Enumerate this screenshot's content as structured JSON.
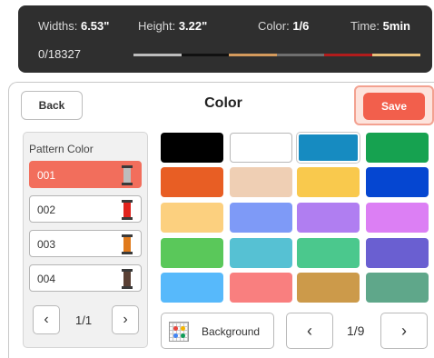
{
  "status": {
    "widths_label": "Widths:",
    "widths_value": "6.53\"",
    "height_label": "Height:",
    "height_value": "3.22\"",
    "color_label": "Color:",
    "color_value": "1/6",
    "time_label": "Time:",
    "time_value": "5min",
    "counter": "0/18327",
    "progress_colors": [
      "#bdbdbd",
      "#111111",
      "#d49a5c",
      "#6f6f6f",
      "#b21c1c",
      "#e8c07a"
    ]
  },
  "header": {
    "back_label": "Back",
    "title": "Color",
    "save_label": "Save"
  },
  "pattern": {
    "label": "Pattern Color",
    "items": [
      {
        "number": "001",
        "color": "#bdbdbd",
        "active": true
      },
      {
        "number": "002",
        "color": "#e0241e",
        "active": false
      },
      {
        "number": "003",
        "color": "#e07a1c",
        "active": false
      },
      {
        "number": "004",
        "color": "#5a4034",
        "active": false
      }
    ],
    "page_text": "1/1",
    "prev_icon": "chevron-left-icon",
    "next_icon": "chevron-right-icon"
  },
  "palette": {
    "swatches": [
      "#000000",
      "#ffffff",
      "#168bc1",
      "#16a250",
      "#e85e24",
      "#efcfb4",
      "#f9c94d",
      "#0546d1",
      "#fcd07f",
      "#7e9af7",
      "#b07ef1",
      "#dc7ff4",
      "#5ac85a",
      "#56c1d3",
      "#4bc88d",
      "#6a5fd1",
      "#57b9fb",
      "#f97f7f",
      "#cc9a4a",
      "#5fa78a"
    ],
    "selected_index": 2,
    "background_label": "Background",
    "background_icon": "grid-palette-icon",
    "page_text": "1/9"
  }
}
